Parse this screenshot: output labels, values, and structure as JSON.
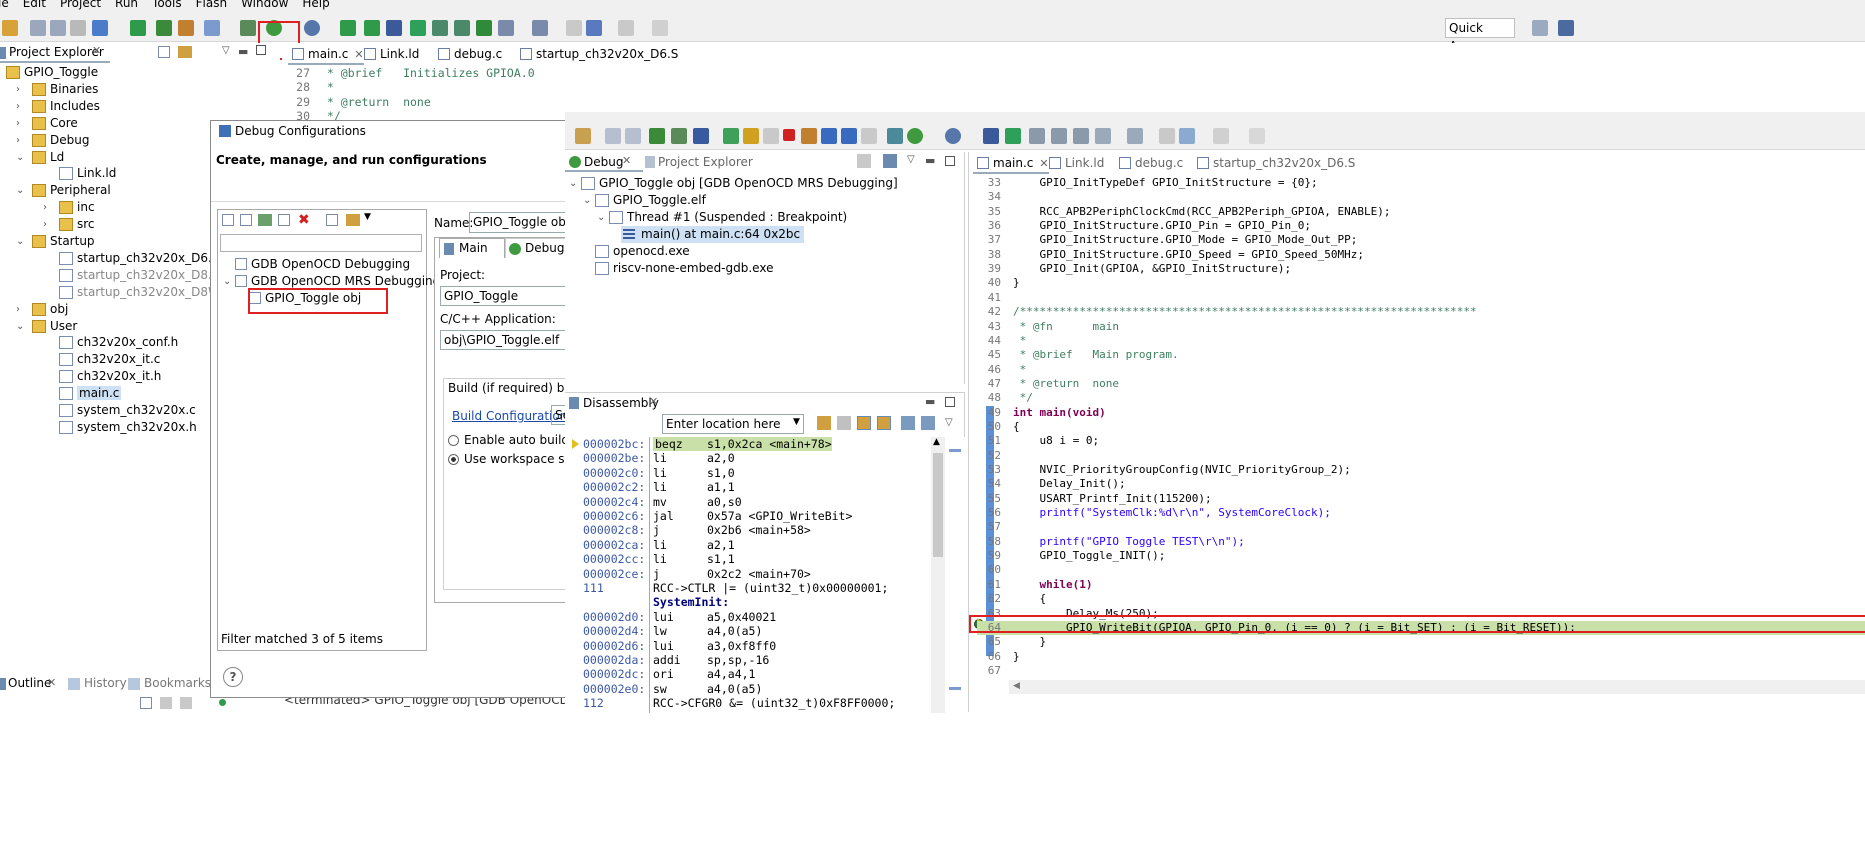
{
  "menu": [
    "le",
    "Edit",
    "Project",
    "Run",
    "Tools",
    "Flash",
    "Window",
    "Help"
  ],
  "quick_access": "Quick Access",
  "project_explorer": {
    "title": "Project Explorer",
    "items": [
      {
        "label": "GPIO_Toggle",
        "depth": 0,
        "type": "project"
      },
      {
        "label": "Binaries",
        "depth": 1,
        "type": "folder"
      },
      {
        "label": "Includes",
        "depth": 1,
        "type": "folder"
      },
      {
        "label": "Core",
        "depth": 1,
        "type": "folder"
      },
      {
        "label": "Debug",
        "depth": 1,
        "type": "folder"
      },
      {
        "label": "Ld",
        "depth": 1,
        "type": "folder"
      },
      {
        "label": "Link.ld",
        "depth": 2,
        "type": "file"
      },
      {
        "label": "Peripheral",
        "depth": 1,
        "type": "folder"
      },
      {
        "label": "inc",
        "depth": 2,
        "type": "folder"
      },
      {
        "label": "src",
        "depth": 2,
        "type": "folder"
      },
      {
        "label": "Startup",
        "depth": 1,
        "type": "folder"
      },
      {
        "label": "startup_ch32v20x_D6.S",
        "depth": 2,
        "type": "file"
      },
      {
        "label": "startup_ch32v20x_D8.S",
        "depth": 2,
        "type": "file-dim"
      },
      {
        "label": "startup_ch32v20x_D8W.S",
        "depth": 2,
        "type": "file-dim"
      },
      {
        "label": "obj",
        "depth": 1,
        "type": "folder"
      },
      {
        "label": "User",
        "depth": 1,
        "type": "folder"
      },
      {
        "label": "ch32v20x_conf.h",
        "depth": 2,
        "type": "file"
      },
      {
        "label": "ch32v20x_it.c",
        "depth": 2,
        "type": "file"
      },
      {
        "label": "ch32v20x_it.h",
        "depth": 2,
        "type": "file"
      },
      {
        "label": "main.c",
        "depth": 2,
        "type": "file-sel"
      },
      {
        "label": "system_ch32v20x.c",
        "depth": 2,
        "type": "file"
      },
      {
        "label": "system_ch32v20x.h",
        "depth": 2,
        "type": "file"
      }
    ]
  },
  "bottom_tabs": {
    "outline": "Outline",
    "history": "History",
    "bookmarks": "Bookmarks"
  },
  "console_status": "<terminated> GPIO_Toggle obj [GDB OpenOCD MRS Debugging] openocd.exe",
  "editor_back": {
    "tabs": [
      "main.c",
      "Link.ld",
      "debug.c",
      "startup_ch32v20x_D6.S"
    ],
    "lines": [
      {
        "n": "27",
        "t": " * @brief   Initializes GPIOA.0"
      },
      {
        "n": "28",
        "t": " *"
      },
      {
        "n": "29",
        "t": " * @return  none"
      },
      {
        "n": "30",
        "t": " */"
      }
    ]
  },
  "debug_config": {
    "title": "Debug Configurations",
    "header": "Create, manage, and run configurations",
    "tree": [
      {
        "label": "GDB OpenOCD Debugging",
        "depth": 0
      },
      {
        "label": "GDB OpenOCD MRS Debugging",
        "depth": 0
      },
      {
        "label": "GPIO_Toggle obj",
        "depth": 1
      }
    ],
    "filter_status": "Filter matched 3 of 5 items",
    "name_label": "Name:",
    "name_value": "GPIO_Toggle obj",
    "tab_main": "Main",
    "tab_debugger": "Debugger",
    "project_label": "Project:",
    "project_value": "GPIO_Toggle",
    "app_label": "C/C++ Application:",
    "app_value": "obj\\GPIO_Toggle.elf",
    "build_label": "Build (if required) befor",
    "build_config_link": "Build Configuration:",
    "build_config_value": "Se",
    "enable_auto": "Enable auto build",
    "use_workspace": "Use workspace settin"
  },
  "debug_view": {
    "tab_debug": "Debug",
    "tab_project": "Project Explorer",
    "items": [
      {
        "label": "GPIO_Toggle obj [GDB OpenOCD MRS Debugging]",
        "depth": 0
      },
      {
        "label": "GPIO_Toggle.elf",
        "depth": 1
      },
      {
        "label": "Thread #1 (Suspended : Breakpoint)",
        "depth": 2
      },
      {
        "label": "main() at main.c:64 0x2bc",
        "depth": 3
      },
      {
        "label": "openocd.exe",
        "depth": 1
      },
      {
        "label": "riscv-none-embed-gdb.exe",
        "depth": 1
      }
    ]
  },
  "disassembly": {
    "title": "Disassembly",
    "location_placeholder": "Enter location here",
    "lines": [
      {
        "a": "000002bc:",
        "op": "beqz",
        "args": "s1,0x2ca <main+78>",
        "hl": true
      },
      {
        "a": "000002be:",
        "op": "li",
        "args": "a2,0"
      },
      {
        "a": "000002c0:",
        "op": "li",
        "args": "s1,0"
      },
      {
        "a": "000002c2:",
        "op": "li",
        "args": "a1,1"
      },
      {
        "a": "000002c4:",
        "op": "mv",
        "args": "a0,s0"
      },
      {
        "a": "000002c6:",
        "op": "jal",
        "args": "0x57a <GPIO_WriteBit>"
      },
      {
        "a": "000002c8:",
        "op": "j",
        "args": "0x2b6 <main+58>"
      },
      {
        "a": "000002ca:",
        "op": "li",
        "args": "a2,1"
      },
      {
        "a": "000002cc:",
        "op": "li",
        "args": "s1,1"
      },
      {
        "a": "000002ce:",
        "op": "j",
        "args": "0x2c2 <main+70>"
      },
      {
        "a": "111",
        "op": "",
        "args": "RCC->CTLR |= (uint32_t)0x00000001;",
        "src": true
      },
      {
        "a": "",
        "op": "SystemInit:",
        "args": "",
        "label": true
      },
      {
        "a": "000002d0:",
        "op": "lui",
        "args": "a5,0x40021"
      },
      {
        "a": "000002d4:",
        "op": "lw",
        "args": "a4,0(a5)"
      },
      {
        "a": "000002d6:",
        "op": "lui",
        "args": "a3,0xf8ff0"
      },
      {
        "a": "000002da:",
        "op": "addi",
        "args": "sp,sp,-16"
      },
      {
        "a": "000002dc:",
        "op": "ori",
        "args": "a4,a4,1"
      },
      {
        "a": "000002e0:",
        "op": "sw",
        "args": "a4,0(a5)"
      },
      {
        "a": "112",
        "op": "",
        "args": "RCC->CFGR0 &= (uint32_t)0xF8FF0000;",
        "src": true
      }
    ]
  },
  "editor": {
    "tabs": [
      "main.c",
      "Link.ld",
      "debug.c",
      "startup_ch32v20x_D6.S"
    ],
    "lines": [
      {
        "n": "33",
        "t": "    GPIO_InitTypeDef GPIO_InitStructure = {0};"
      },
      {
        "n": "34",
        "t": ""
      },
      {
        "n": "35",
        "t": "    RCC_APB2PeriphClockCmd(RCC_APB2Periph_GPIOA, ENABLE);"
      },
      {
        "n": "36",
        "t": "    GPIO_InitStructure.GPIO_Pin = GPIO_Pin_0;"
      },
      {
        "n": "37",
        "t": "    GPIO_InitStructure.GPIO_Mode = GPIO_Mode_Out_PP;"
      },
      {
        "n": "38",
        "t": "    GPIO_InitStructure.GPIO_Speed = GPIO_Speed_50MHz;"
      },
      {
        "n": "39",
        "t": "    GPIO_Init(GPIOA, &GPIO_InitStructure);"
      },
      {
        "n": "40",
        "t": "}"
      },
      {
        "n": "41",
        "t": ""
      },
      {
        "n": "42",
        "t": "/*********************************************************************"
      },
      {
        "n": "43",
        "t": " * @fn      main"
      },
      {
        "n": "44",
        "t": " *"
      },
      {
        "n": "45",
        "t": " * @brief   Main program."
      },
      {
        "n": "46",
        "t": " *"
      },
      {
        "n": "47",
        "t": " * @return  none"
      },
      {
        "n": "48",
        "t": " */"
      },
      {
        "n": "49",
        "t": "int main(void)"
      },
      {
        "n": "50",
        "t": "{"
      },
      {
        "n": "51",
        "t": "    u8 i = 0;"
      },
      {
        "n": "52",
        "t": ""
      },
      {
        "n": "53",
        "t": "    NVIC_PriorityGroupConfig(NVIC_PriorityGroup_2);"
      },
      {
        "n": "54",
        "t": "    Delay_Init();"
      },
      {
        "n": "55",
        "t": "    USART_Printf_Init(115200);"
      },
      {
        "n": "56",
        "t": "    printf(\"SystemClk:%d\\r\\n\", SystemCoreClock);"
      },
      {
        "n": "57",
        "t": ""
      },
      {
        "n": "58",
        "t": "    printf(\"GPIO Toggle TEST\\r\\n\");"
      },
      {
        "n": "59",
        "t": "    GPIO_Toggle_INIT();"
      },
      {
        "n": "60",
        "t": ""
      },
      {
        "n": "61",
        "t": "    while(1)"
      },
      {
        "n": "62",
        "t": "    {"
      },
      {
        "n": "63",
        "t": "        Delay_Ms(250);"
      },
      {
        "n": "64",
        "t": "        GPIO_WriteBit(GPIOA, GPIO_Pin_0, (i == 0) ? (i = Bit_SET) : (i = Bit_RESET));",
        "hl": true
      },
      {
        "n": "65",
        "t": "    }"
      },
      {
        "n": "66",
        "t": "}"
      },
      {
        "n": "67",
        "t": ""
      }
    ]
  }
}
